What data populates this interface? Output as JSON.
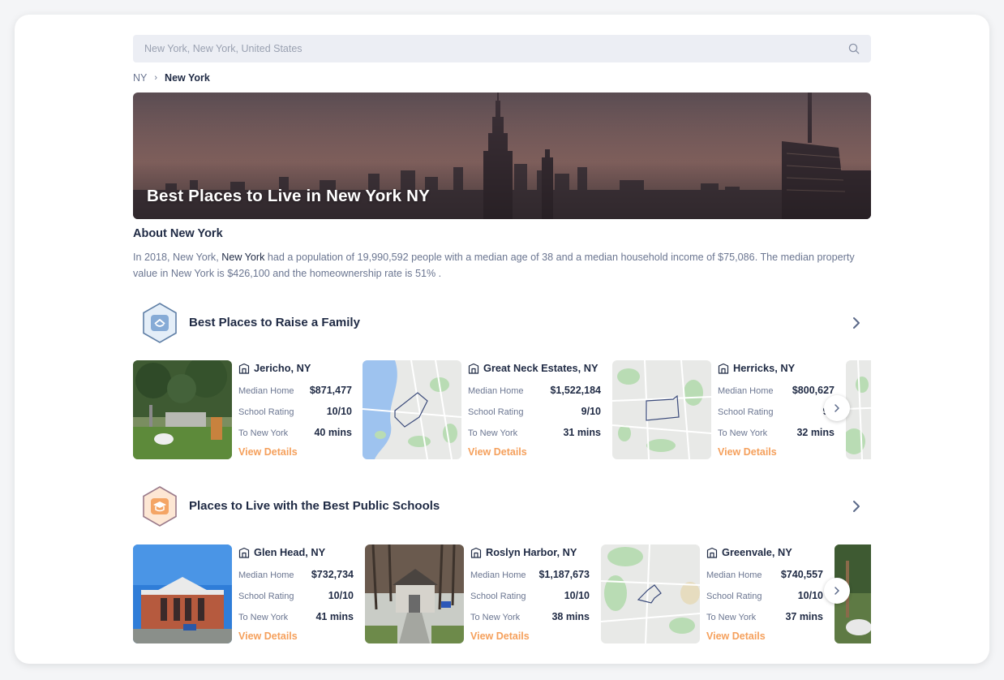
{
  "search": {
    "value": "New York, New York, United States",
    "icon": "search-icon"
  },
  "breadcrumb": {
    "parent": "NY",
    "separator": "›",
    "current": "New York"
  },
  "hero": {
    "title": "Best Places to Live in New York NY"
  },
  "about": {
    "heading": "About New York",
    "text_prefix": "In 2018, New York, ",
    "text_city": "New York",
    "text_rest": " had a population of 19,990,592 people with a median age of 38 and a median household income of $75,086. The median property value in New York is $426,100 and the homeownership rate is 51% ."
  },
  "colors": {
    "accent_orange": "#f5a05c",
    "navy": "#1f2a44",
    "muted": "#6b7691"
  },
  "sections": [
    {
      "title": "Best Places to Raise a Family",
      "badge_icon": "home-icon",
      "cards": [
        {
          "name": "Jericho, NY",
          "thumb": "photo",
          "median_label": "Median Home",
          "median": "$871,477",
          "school_label": "School Rating",
          "school": "10/10",
          "commute_label": "To New York",
          "commute": "40 mins",
          "cta": "View Details"
        },
        {
          "name": "Great Neck Estates, NY",
          "thumb": "map",
          "median_label": "Median Home",
          "median": "$1,522,184",
          "school_label": "School Rating",
          "school": "9/10",
          "commute_label": "To New York",
          "commute": "31 mins",
          "cta": "View Details"
        },
        {
          "name": "Herricks, NY",
          "thumb": "map",
          "median_label": "Median Home",
          "median": "$800,627",
          "school_label": "School Rating",
          "school": "9/",
          "commute_label": "To New York",
          "commute": "32 mins",
          "cta": "View Details"
        }
      ]
    },
    {
      "title": "Places to Live with the Best Public Schools",
      "badge_icon": "graduation-cap-icon",
      "cards": [
        {
          "name": "Glen Head, NY",
          "thumb": "photo",
          "median_label": "Median Home",
          "median": "$732,734",
          "school_label": "School Rating",
          "school": "10/10",
          "commute_label": "To New York",
          "commute": "41 mins",
          "cta": "View Details"
        },
        {
          "name": "Roslyn Harbor, NY",
          "thumb": "photo",
          "median_label": "Median Home",
          "median": "$1,187,673",
          "school_label": "School Rating",
          "school": "10/10",
          "commute_label": "To New York",
          "commute": "38 mins",
          "cta": "View Details"
        },
        {
          "name": "Greenvale, NY",
          "thumb": "map",
          "median_label": "Median Home",
          "median": "$740,557",
          "school_label": "School Rating",
          "school": "10/10",
          "commute_label": "To New York",
          "commute": "37 mins",
          "cta": "View Details"
        }
      ]
    }
  ]
}
